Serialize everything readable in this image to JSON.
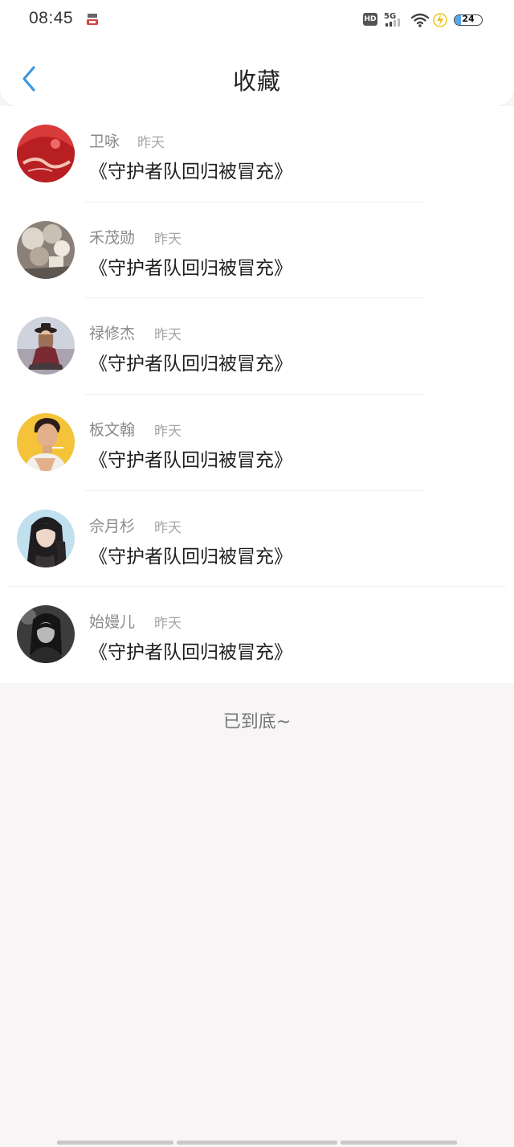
{
  "status_bar": {
    "time": "08:45",
    "network": "5G",
    "hd_label": "HD",
    "battery_level": "24",
    "battery_fraction": 0.24
  },
  "header": {
    "title": "收藏"
  },
  "items": [
    {
      "author": "卫咏",
      "time_ago": "昨天",
      "title": "《守护者队回归被冒充》"
    },
    {
      "author": "禾茂勋",
      "time_ago": "昨天",
      "title": "《守护者队回归被冒充》"
    },
    {
      "author": "禄修杰",
      "time_ago": "昨天",
      "title": "《守护者队回归被冒充》"
    },
    {
      "author": "板文翰",
      "time_ago": "昨天",
      "title": "《守护者队回归被冒充》"
    },
    {
      "author": "佘月杉",
      "time_ago": "昨天",
      "title": "《守护者队回归被冒充》"
    },
    {
      "author": "始嫚儿",
      "time_ago": "昨天",
      "title": "《守护者队回归被冒充》"
    }
  ],
  "footer": {
    "end_text": "已到底~"
  },
  "colors": {
    "accent": "#3b97e0",
    "background": "#f7f5f6"
  }
}
